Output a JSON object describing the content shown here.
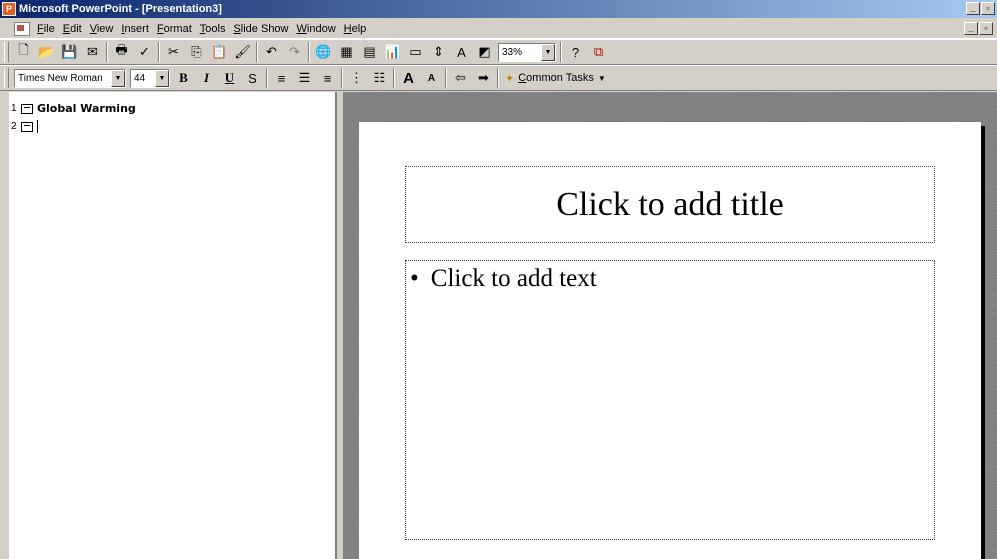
{
  "window": {
    "title": "Microsoft PowerPoint - [Presentation3]",
    "minimize": "_",
    "restore": "▫"
  },
  "menu": [
    "File",
    "Edit",
    "View",
    "Insert",
    "Format",
    "Tools",
    "Slide Show",
    "Window",
    "Help"
  ],
  "toolbar": {
    "zoom": "33%",
    "font_name": "Times New Roman",
    "font_size": "44",
    "bold": "B",
    "italic": "I",
    "underline": "U",
    "shadow": "S",
    "common_tasks": "Common Tasks"
  },
  "outline": {
    "slides": [
      {
        "number": "1",
        "title": "Global Warming"
      },
      {
        "number": "2",
        "title": ""
      }
    ]
  },
  "slide": {
    "title_placeholder": "Click to add title",
    "body_placeholder": "Click to add text",
    "bullet": "•"
  }
}
